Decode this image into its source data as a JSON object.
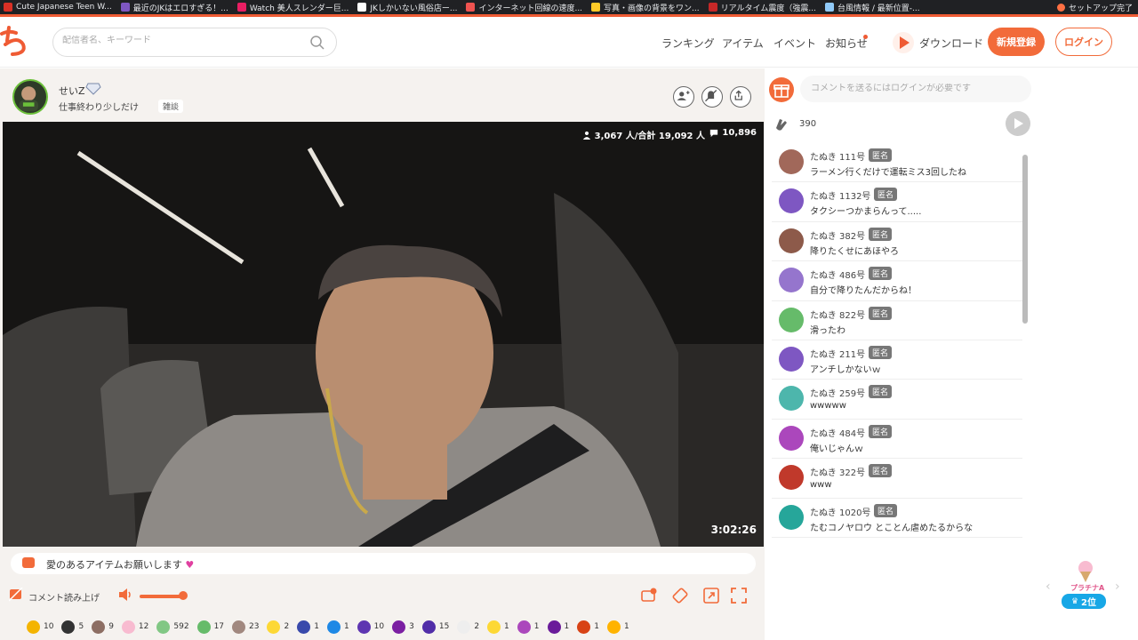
{
  "bookmarks": [
    {
      "label": "Cute Japanese Teen W...",
      "color": "#d93025"
    },
    {
      "label": "最近のJKはエロすぎる！...",
      "color": "#7e57c2"
    },
    {
      "label": "Watch 美人スレンダー巨...",
      "color": "#e91e63"
    },
    {
      "label": "JKしかいない風俗店ー...",
      "color": "#ffffff"
    },
    {
      "label": "インターネット回線の速度...",
      "color": "#ef5350"
    },
    {
      "label": "写真・画像の背景をワン...",
      "color": "#ffca28"
    },
    {
      "label": "リアルタイム震度（強震...",
      "color": "#c62828"
    },
    {
      "label": "台風情報 / 最新位置-...",
      "color": "#90caf9"
    }
  ],
  "bookmarks_right": "セットアップ完了",
  "header": {
    "search_placeholder": "配信者名、キーワード",
    "nav": {
      "ranking": "ランキング",
      "items": "アイテム",
      "events": "イベント",
      "notices": "お知らせ",
      "download": "ダウンロード"
    },
    "signup": "新規登録",
    "login": "ログイン"
  },
  "stream": {
    "streamer_name": "せいZ",
    "title": "仕事終わり少しだけ",
    "tag": "雑談",
    "viewers": "3,067 人/合計 19,092 人",
    "comments": "10,896",
    "elapsed": "3:02:26",
    "pinned_message": "愛のあるアイテムお願いします",
    "readout_label": "コメント読み上げ",
    "volume_level": 0.9
  },
  "gifts": [
    {
      "count": "10",
      "color": "#f4b400"
    },
    {
      "count": "5",
      "color": "#333333"
    },
    {
      "count": "9",
      "color": "#8d6e63"
    },
    {
      "count": "12",
      "color": "#f8bbd0"
    },
    {
      "count": "592",
      "color": "#81c784"
    },
    {
      "count": "17",
      "color": "#66bb6a"
    },
    {
      "count": "23",
      "color": "#a1887f"
    },
    {
      "count": "2",
      "color": "#fdd835"
    },
    {
      "count": "1",
      "color": "#3949ab"
    },
    {
      "count": "1",
      "color": "#1e88e5"
    },
    {
      "count": "10",
      "color": "#5e35b1"
    },
    {
      "count": "3",
      "color": "#7b1fa2"
    },
    {
      "count": "15",
      "color": "#512da8"
    },
    {
      "count": "2",
      "color": "#eeeeee"
    },
    {
      "count": "1",
      "color": "#fdd835"
    },
    {
      "count": "1",
      "color": "#ab47bc"
    },
    {
      "count": "1",
      "color": "#6a1b9a"
    },
    {
      "count": "1",
      "color": "#d84315"
    },
    {
      "count": "1",
      "color": "#ffb300"
    }
  ],
  "chat": {
    "placeholder": "コメントを送るにはログインが必要です",
    "clap_count": "390",
    "anon_label": "匿名",
    "messages": [
      {
        "name": "たぬき 111号",
        "text": "ラーメン行くだけで運転ミス3回したね",
        "avatar": "#a1685a"
      },
      {
        "name": "たぬき 1132号",
        "text": "タクシーつかまらんって.....",
        "avatar": "#7e57c2"
      },
      {
        "name": "たぬき 382号",
        "text": "降りたくせにあほやろ",
        "avatar": "#8d5a4a"
      },
      {
        "name": "たぬき 486号",
        "text": "自分で降りたんだからね！",
        "avatar": "#9575cd"
      },
      {
        "name": "たぬき 822号",
        "text": "滑ったわ",
        "avatar": "#66bb6a"
      },
      {
        "name": "たぬき 211号",
        "text": "アンチしかないｗ",
        "avatar": "#7e57c2"
      },
      {
        "name": "たぬき 259号",
        "text": "wwwww",
        "avatar": "#4db6ac"
      },
      {
        "name": "たぬき 484号",
        "text": "俺いじゃんｗ",
        "avatar": "#ab47bc"
      },
      {
        "name": "たぬき 322号",
        "text": "www",
        "avatar": "#c0392b"
      },
      {
        "name": "たぬき 1020号",
        "text": "たむコノヤロウ とことん虐めたるからな",
        "avatar": "#26a69a"
      }
    ]
  },
  "rank_widget": {
    "label": "プラチナA",
    "rank": "2位"
  }
}
